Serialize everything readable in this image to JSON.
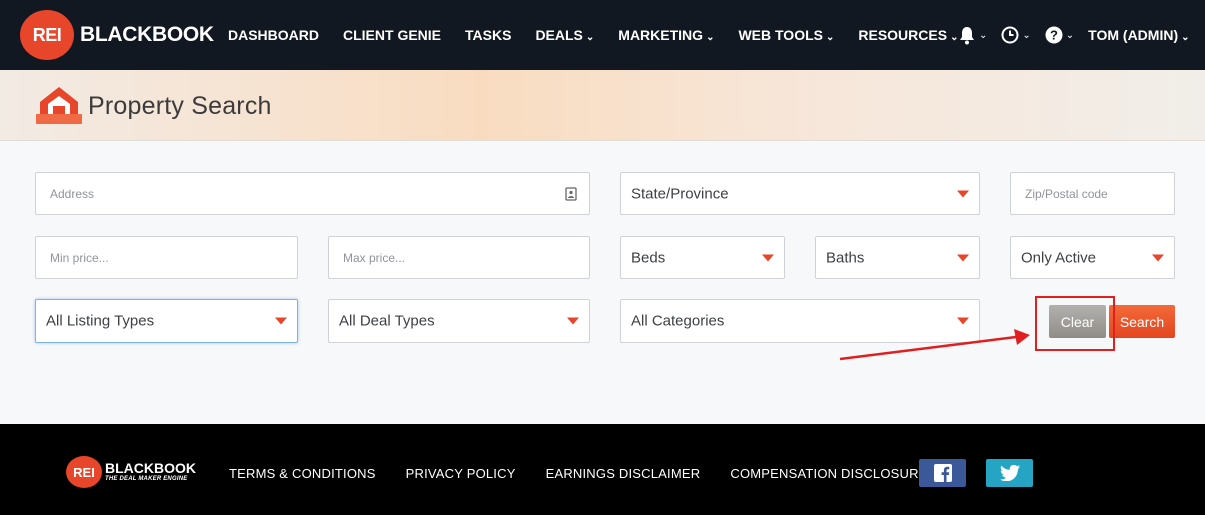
{
  "brand": {
    "logo_badge": "REI",
    "logo_text": "BLACKBOOK"
  },
  "nav": {
    "items": [
      {
        "label": "DASHBOARD",
        "dropdown": false
      },
      {
        "label": "CLIENT GENIE",
        "dropdown": false
      },
      {
        "label": "TASKS",
        "dropdown": false
      },
      {
        "label": "DEALS",
        "dropdown": true
      },
      {
        "label": "MARKETING",
        "dropdown": true
      },
      {
        "label": "WEB TOOLS",
        "dropdown": true
      },
      {
        "label": "RESOURCES",
        "dropdown": true
      }
    ],
    "icons": [
      "bell-icon",
      "clock-icon",
      "help-icon"
    ],
    "user": "TOM (ADMIN)"
  },
  "page": {
    "title": "Property Search"
  },
  "form": {
    "address_placeholder": "Address",
    "state": "State/Province",
    "zip_placeholder": "Zip/Postal code",
    "min_price_placeholder": "Min price...",
    "max_price_placeholder": "Max price...",
    "beds": "Beds",
    "baths": "Baths",
    "status": "Only Active",
    "listing_types": "All Listing Types",
    "deal_types": "All Deal Types",
    "categories": "All Categories",
    "clear_label": "Clear",
    "search_label": "Search"
  },
  "footer": {
    "logo_badge": "REI",
    "logo_text": "BLACKBOOK",
    "logo_tagline": "THE DEAL MAKER ENGINE",
    "links": [
      "TERMS & CONDITIONS",
      "PRIVACY POLICY",
      "EARNINGS DISCLAIMER",
      "COMPENSATION DISCLOSURE"
    ]
  },
  "colors": {
    "nav_bg": "#121821",
    "accent": "#e8462a",
    "clear_button": "#a3a09c",
    "annotation": "#e02020",
    "facebook": "#3b5998",
    "twitter": "#26a4c4"
  }
}
